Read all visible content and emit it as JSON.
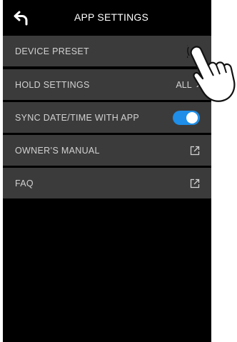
{
  "header": {
    "title": "APP SETTINGS",
    "back_icon": "back-arrow-icon"
  },
  "settings": [
    {
      "label": "DEVICE PRESET",
      "trailing": ""
    },
    {
      "label": "HOLD SETTINGS",
      "value": "ALL",
      "trailing": "chevron-right-icon"
    },
    {
      "label": "SYNC DATE/TIME WITH APP",
      "toggle": true,
      "trailing": "toggle-switch"
    },
    {
      "label": "OWNER’S MANUAL",
      "trailing": "external-link-icon"
    },
    {
      "label": "FAQ",
      "trailing": "external-link-icon"
    }
  ],
  "colors": {
    "background": "#000000",
    "row": "#3b3b3b",
    "toggle_on": "#1e8ee8",
    "text": "#d2d2d2"
  },
  "overlay": {
    "icon": "tap-hand-icon"
  }
}
